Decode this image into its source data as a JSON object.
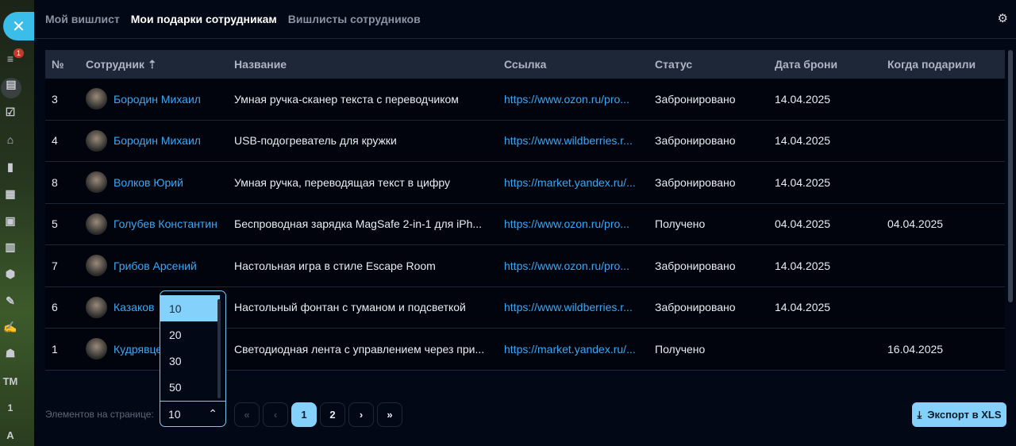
{
  "sidebar": {
    "badge": "1",
    "labels": [
      "TM",
      "1",
      "A"
    ]
  },
  "tabs": [
    "Мой вишлист",
    "Мои подарки сотрудникам",
    "Вишлисты сотрудников"
  ],
  "table": {
    "headers": [
      "№",
      "Сотрудник ⇡",
      "Название",
      "Ссылка",
      "Статус",
      "Дата брони",
      "Когда подарили"
    ],
    "rows": [
      {
        "n": "3",
        "emp": "Бородин Михаил",
        "name": "Умная ручка-сканер текста с переводчиком",
        "link": "https://www.ozon.ru/pro...",
        "status": "Забронировано",
        "booked": "14.04.2025",
        "given": ""
      },
      {
        "n": "4",
        "emp": "Бородин Михаил",
        "name": "USB-подогреватель для кружки",
        "link": "https://www.wildberries.r...",
        "status": "Забронировано",
        "booked": "14.04.2025",
        "given": ""
      },
      {
        "n": "8",
        "emp": "Волков Юрий",
        "name": "Умная ручка, переводящая текст в цифру",
        "link": "https://market.yandex.ru/...",
        "status": "Забронировано",
        "booked": "14.04.2025",
        "given": ""
      },
      {
        "n": "5",
        "emp": "Голубев Константин",
        "name": "Беспроводная зарядка MagSafe 2-in-1 для iPh...",
        "link": "https://www.ozon.ru/pro...",
        "status": "Получено",
        "booked": "04.04.2025",
        "given": "04.04.2025"
      },
      {
        "n": "7",
        "emp": "Грибов Арсений",
        "name": "Настольная игра в стиле Escape Room",
        "link": "https://www.ozon.ru/pro...",
        "status": "Забронировано",
        "booked": "14.04.2025",
        "given": ""
      },
      {
        "n": "6",
        "emp": "Казаков",
        "name": "Настольный фонтан с туманом и подсветкой",
        "link": "https://www.wildberries.r...",
        "status": "Забронировано",
        "booked": "14.04.2025",
        "given": ""
      },
      {
        "n": "1",
        "emp": "Кудрявце",
        "name": "Светодиодная лента с управлением через при...",
        "link": "https://market.yandex.ru/...",
        "status": "Получено",
        "booked": "",
        "given": "16.04.2025"
      }
    ]
  },
  "footer": {
    "page_size_label": "Элементов на странице:",
    "page_size": "10",
    "options": [
      "10",
      "20",
      "30",
      "50"
    ],
    "pages": [
      "1",
      "2"
    ],
    "export": "Экспорт в XLS"
  }
}
